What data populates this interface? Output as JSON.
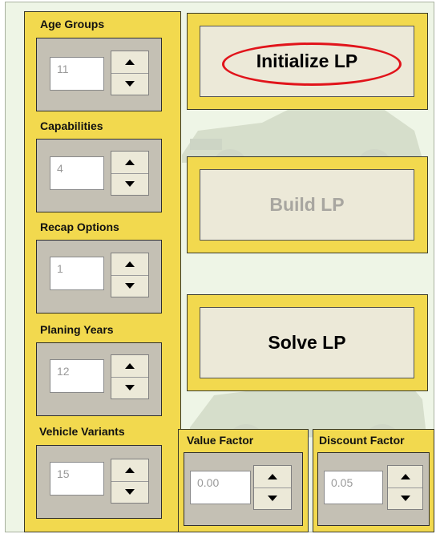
{
  "spinners": [
    {
      "label": "Age Groups",
      "value": "11"
    },
    {
      "label": "Capabilities",
      "value": "4"
    },
    {
      "label": "Recap Options",
      "value": "1"
    },
    {
      "label": "Planing Years",
      "value": "12"
    },
    {
      "label": "Vehicle Variants",
      "value": "15"
    }
  ],
  "factors": [
    {
      "label": "Value Factor",
      "value": "0.00"
    },
    {
      "label": "Discount Factor",
      "value": "0.05"
    }
  ],
  "buttons": {
    "initialize": "Initialize LP",
    "build": "Build LP",
    "solve": "Solve LP"
  },
  "colors": {
    "panel": "#f2d94e",
    "background": "#eef5e6",
    "highlight_ring": "#e1141b"
  },
  "icons": {
    "spinner_up": "triangle-up-icon",
    "spinner_down": "triangle-down-icon"
  }
}
